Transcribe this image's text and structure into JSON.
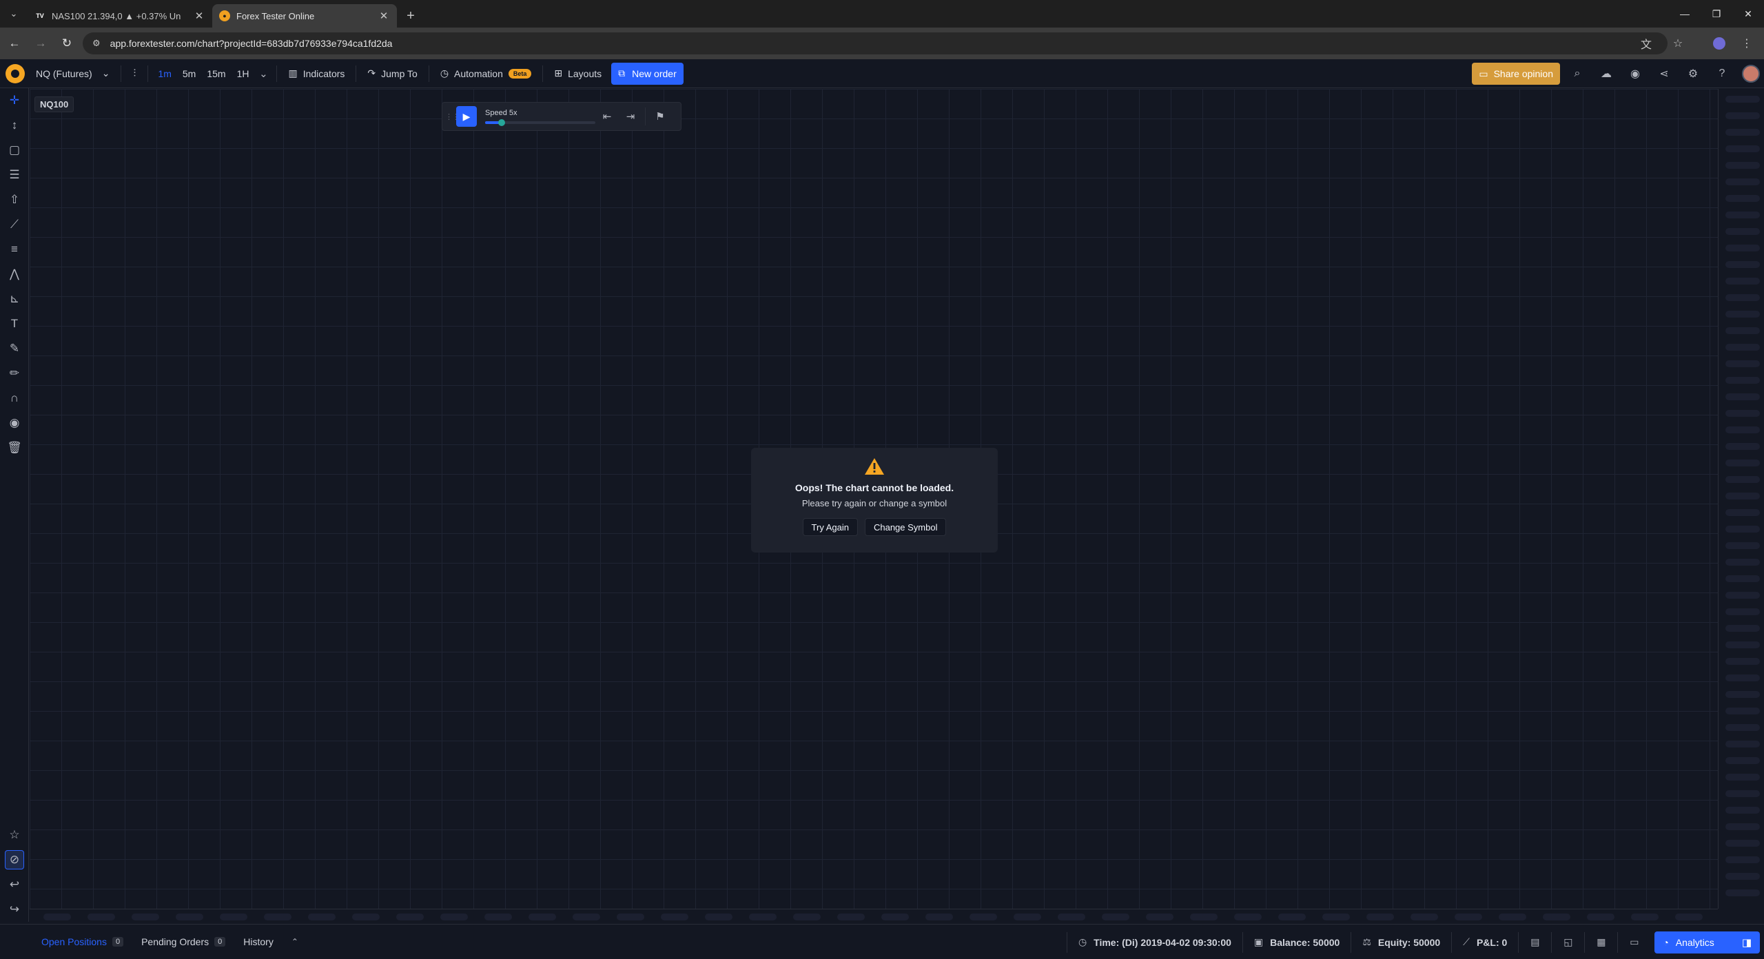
{
  "browser": {
    "tabs": [
      {
        "title": "NAS100 21.394,0 ▲ +0.37% Un",
        "favicon": "tradingview-icon",
        "active": false
      },
      {
        "title": "Forex Tester Online",
        "favicon": "forextester-icon",
        "active": true
      }
    ],
    "url": "app.forextester.com/chart?projectId=683db7d76933e794ca1fd2da"
  },
  "toolbar": {
    "symbol": "NQ (Futures)",
    "timeframes": [
      "1m",
      "5m",
      "15m",
      "1H"
    ],
    "active_timeframe": "1m",
    "indicators_label": "Indicators",
    "jump_to_label": "Jump To",
    "automation_label": "Automation",
    "beta_label": "Beta",
    "layouts_label": "Layouts",
    "new_order_label": "New order",
    "share_label": "Share opinion"
  },
  "chart": {
    "symbol_label": "NQ100",
    "player": {
      "speed_label": "Speed 5x",
      "speed_fraction": 0.15
    },
    "error": {
      "title": "Oops! The chart cannot be loaded.",
      "subtitle": "Please try again or change a symbol",
      "try_again_label": "Try Again",
      "change_symbol_label": "Change Symbol"
    }
  },
  "bottom": {
    "tabs": [
      {
        "label": "Open Positions",
        "count": "0"
      },
      {
        "label": "Pending Orders",
        "count": "0"
      },
      {
        "label": "History"
      }
    ],
    "time": "Time: (Di) 2019-04-02 09:30:00",
    "balance": "Balance: 50000",
    "equity": "Equity: 50000",
    "pnl": "P&L: 0",
    "analytics_label": "Analytics"
  },
  "colors": {
    "accent": "#2962ff",
    "background": "#131722",
    "share_button": "#d69c3c",
    "warning": "#f5a623"
  }
}
